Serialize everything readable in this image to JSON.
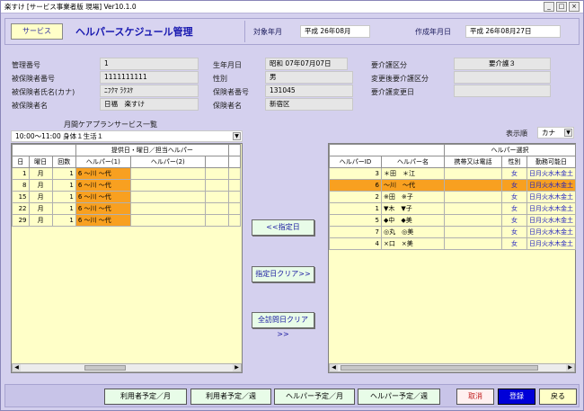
{
  "window": {
    "title": "楽すけ [サービス事業者版 現場] Ver10.1.0"
  },
  "header": {
    "service_button": "サービス",
    "app_title": "ヘルパースケジュール管理",
    "target_label": "対象年月",
    "target_value": "平成 26年08月",
    "created_label": "作成年月日",
    "created_value": "平成 26年08月27日"
  },
  "client": {
    "mgmt_no_label": "管理番号",
    "mgmt_no": "1",
    "insured_no_label": "被保険者番号",
    "insured_no": "1111111111",
    "kana_label": "被保険者氏名(カナ)",
    "kana": "ﾆﾌｸﾏ ﾗｸｽｹ",
    "name_label": "被保険者名",
    "name": "日福　楽すけ",
    "birth_label": "生年月日",
    "birth": "昭和 07年07月07日",
    "sex_label": "性別",
    "sex": "男",
    "insurer_no_label": "保険者番号",
    "insurer_no": "131045",
    "insurer_name_label": "保険者名",
    "insurer_name": "新宿区",
    "care_label": "要介護区分",
    "care": "要介護３",
    "care_change_label": "変更後要介護区分",
    "care_change": "",
    "care_change_date_label": "要介護変更日",
    "care_change_date": ""
  },
  "monthly": {
    "title": "月間ケアプランサービス一覧",
    "selected": "10:00～11:00 身体１生活１",
    "head_group": "提供日・曜日／担当ヘルパー",
    "cols": [
      "日",
      "曜日",
      "回数",
      "ヘルパー(1)",
      "ヘルパー(2)"
    ],
    "rows": [
      {
        "day": "1",
        "dow": "月",
        "count": "1",
        "h1": "6 〜川 〜代",
        "h2": ""
      },
      {
        "day": "8",
        "dow": "月",
        "count": "1",
        "h1": "6 〜川 〜代",
        "h2": ""
      },
      {
        "day": "15",
        "dow": "月",
        "count": "1",
        "h1": "6 〜川 〜代",
        "h2": ""
      },
      {
        "day": "22",
        "dow": "月",
        "count": "1",
        "h1": "6 〜川 〜代",
        "h2": ""
      },
      {
        "day": "29",
        "dow": "月",
        "count": "1",
        "h1": "6 〜川 〜代",
        "h2": ""
      }
    ]
  },
  "helper": {
    "order_label": "表示順",
    "order_value": "カナ",
    "head_group": "ヘルパー選択",
    "cols": [
      "ヘルパーID",
      "ヘルパー名",
      "携帯又は電話",
      "性別",
      "勤務可能日"
    ],
    "rows": [
      {
        "id": "3",
        "name": "＊田　＊江",
        "phone": "",
        "sex": "女",
        "days": "日月火水木金土",
        "sel": false
      },
      {
        "id": "6",
        "name": "〜川　〜代",
        "phone": "",
        "sex": "女",
        "days": "日月火水木金土",
        "sel": true
      },
      {
        "id": "2",
        "name": "※田　※子",
        "phone": "",
        "sex": "女",
        "days": "日月火水木金土",
        "sel": false
      },
      {
        "id": "1",
        "name": "▼木　▼子",
        "phone": "",
        "sex": "女",
        "days": "日月火水木金土",
        "sel": false
      },
      {
        "id": "5",
        "name": "◆中　◆美",
        "phone": "",
        "sex": "女",
        "days": "日月火水木金土",
        "sel": false
      },
      {
        "id": "7",
        "name": "◎丸　◎美",
        "phone": "",
        "sex": "女",
        "days": "日月火水木金土",
        "sel": false
      },
      {
        "id": "4",
        "name": "×口　×美",
        "phone": "",
        "sex": "女",
        "days": "日月火水木金土",
        "sel": false
      }
    ]
  },
  "actions": {
    "assign": "<<指定日",
    "clear_selected": "指定日クリア>>",
    "clear_all": "全訪問日クリア>>"
  },
  "footer": {
    "user_month": "利用者予定／月",
    "user_week": "利用者予定／週",
    "helper_month": "ヘルパー予定／月",
    "helper_week": "ヘルパー予定／週",
    "cancel": "取消",
    "register": "登録",
    "back": "戻る"
  },
  "colors": {
    "window_bg": "#d4d0ee",
    "panel_bg": "#ffffc8",
    "selected": "#f8a020",
    "title_blue": "#1818b0"
  }
}
